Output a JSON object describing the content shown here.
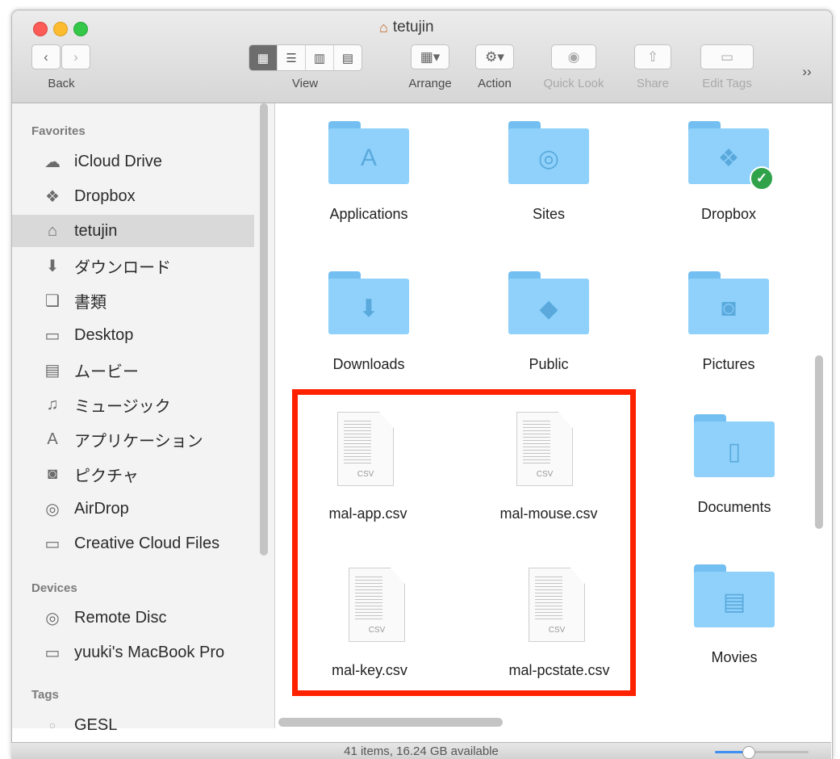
{
  "window": {
    "title": "tetujin"
  },
  "toolbar": {
    "back_label": "Back",
    "view_label": "View",
    "arrange_label": "Arrange",
    "action_label": "Action",
    "quicklook_label": "Quick Look",
    "share_label": "Share",
    "edittags_label": "Edit Tags",
    "overflow": "››"
  },
  "sidebar": {
    "favorites_header": "Favorites",
    "favorites": [
      {
        "label": "iCloud Drive",
        "icon": "cloud-icon"
      },
      {
        "label": "Dropbox",
        "icon": "dropbox-icon"
      },
      {
        "label": "tetujin",
        "icon": "home-icon"
      },
      {
        "label": "ダウンロード",
        "icon": "download-icon"
      },
      {
        "label": "書類",
        "icon": "documents-icon"
      },
      {
        "label": "Desktop",
        "icon": "desktop-icon"
      },
      {
        "label": "ムービー",
        "icon": "movie-icon"
      },
      {
        "label": "ミュージック",
        "icon": "music-icon"
      },
      {
        "label": "アプリケーション",
        "icon": "applications-icon"
      },
      {
        "label": "ピクチャ",
        "icon": "camera-icon"
      },
      {
        "label": "AirDrop",
        "icon": "airdrop-icon"
      },
      {
        "label": "Creative Cloud Files",
        "icon": "folder-icon"
      }
    ],
    "devices_header": "Devices",
    "devices": [
      {
        "label": "Remote Disc",
        "icon": "disc-icon"
      },
      {
        "label": "yuuki's MacBook Pro",
        "icon": "laptop-icon"
      }
    ],
    "tags_header": "Tags",
    "tags": [
      {
        "label": "GESL",
        "icon": "tag-dot-icon"
      }
    ]
  },
  "content": {
    "folders": [
      {
        "label": "Applications",
        "glyph": "applications-icon"
      },
      {
        "label": "Sites",
        "glyph": "compass-icon"
      },
      {
        "label": "Dropbox",
        "glyph": "dropbox-icon"
      },
      {
        "label": "Downloads",
        "glyph": "download-icon"
      },
      {
        "label": "Public",
        "glyph": "public-icon"
      },
      {
        "label": "Pictures",
        "glyph": "camera-icon"
      },
      {
        "label": "Documents",
        "glyph": "document-icon"
      },
      {
        "label": "Movies",
        "glyph": "film-icon"
      }
    ],
    "files": [
      {
        "label": "mal-app.csv",
        "ext": "CSV"
      },
      {
        "label": "mal-mouse.csv",
        "ext": "CSV"
      },
      {
        "label": "mal-key.csv",
        "ext": "CSV"
      },
      {
        "label": "mal-pcstate.csv",
        "ext": "CSV"
      }
    ]
  },
  "status": {
    "text": "41 items, 16.24 GB available",
    "icon_size_level": 0.35
  },
  "colors": {
    "highlight": "#ff2200",
    "folder": "#8fd1fb",
    "selection": "#d9d9d9"
  }
}
